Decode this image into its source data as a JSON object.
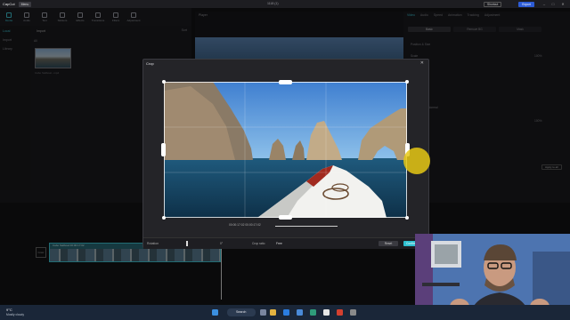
{
  "app": {
    "name": "CapCut",
    "menu_label": "Menu",
    "window_title": "1118 (1)",
    "shortcut_label": "Shortcut",
    "export_label": "Export"
  },
  "toolbar": [
    {
      "label": "Media",
      "icon": "media-icon",
      "active": true
    },
    {
      "label": "Audio",
      "icon": "audio-icon"
    },
    {
      "label": "Text",
      "icon": "text-icon"
    },
    {
      "label": "Stickers",
      "icon": "stickers-icon"
    },
    {
      "label": "Effects",
      "icon": "effects-icon"
    },
    {
      "label": "Transitions",
      "icon": "transitions-icon"
    },
    {
      "label": "Filters",
      "icon": "filters-icon"
    },
    {
      "label": "Adjustment",
      "icon": "adjustment-icon"
    }
  ],
  "side_nav": [
    {
      "label": "Local",
      "selected": true
    },
    {
      "label": "Import"
    },
    {
      "label": "Library"
    }
  ],
  "media_panel": {
    "import_label": "Import",
    "sort_label": "Sort",
    "section_label": "All",
    "thumbnail_name": "Cabo Sailboat...mp4"
  },
  "player": {
    "title": "Player"
  },
  "right_panel": {
    "tabs": [
      "Video",
      "Audio",
      "Speed",
      "Animation",
      "Tracking",
      "Adjustment"
    ],
    "selected_tab": "Video",
    "sub_tabs": [
      "Basic",
      "Remove BG",
      "Mask"
    ],
    "rows": [
      "Position & Size",
      "Scale",
      "100%",
      "Position",
      "Rotate",
      "Blend",
      "Normal",
      "Opacity",
      "100%"
    ],
    "apply_all_label": "Apply to all"
  },
  "crop_dialog": {
    "title": "Crop",
    "timecode": "00:00:17:02  00:00:17:02",
    "rotation_label": "Rotation",
    "rotation_value": "0°",
    "ratio_label": "Crop ratio",
    "ratio_value": "Free",
    "reset_label": "Reset",
    "confirm_label": "Confirm"
  },
  "timeline": {
    "clip_name": "Cabo Sailboat  00:00:17:02",
    "cover_label": "Cover"
  },
  "taskbar": {
    "temperature": "9°C",
    "weather": "Mostly cloudy",
    "search_label": "Search"
  },
  "colors": {
    "accent": "#3fc8d7",
    "export": "#2d5cd6",
    "cursor_highlight": "#e6c814"
  }
}
